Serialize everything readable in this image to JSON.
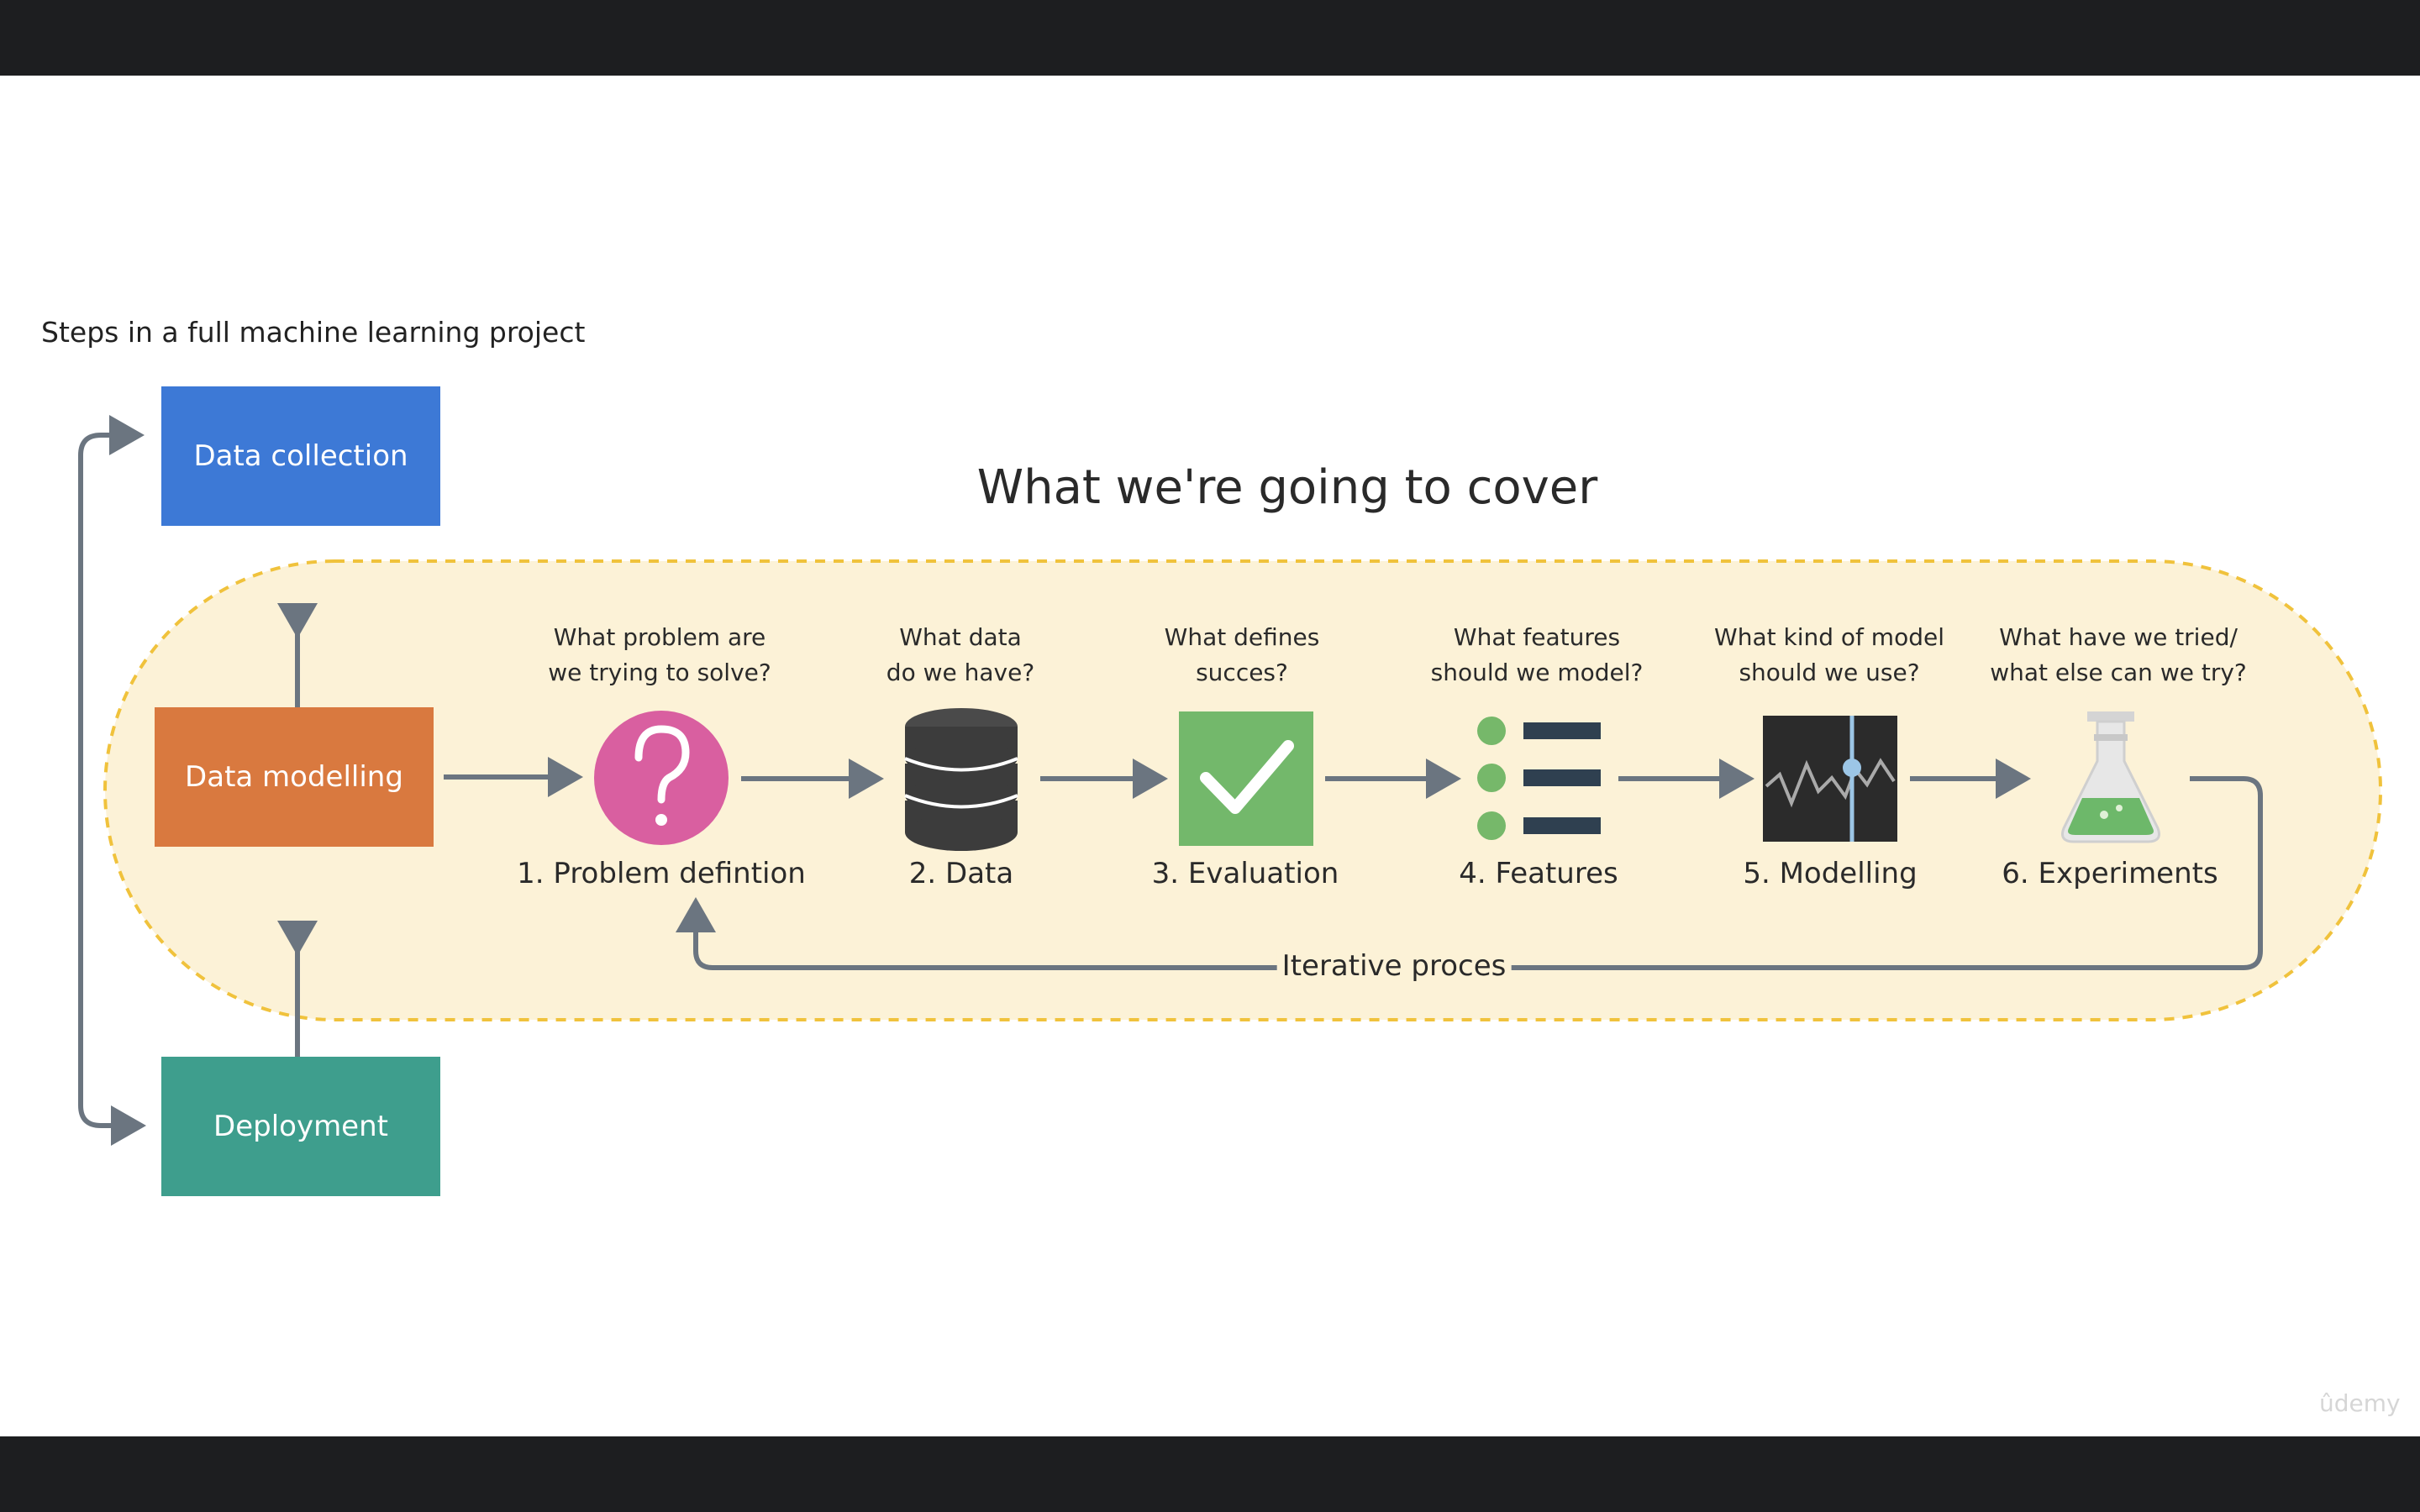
{
  "slide": {
    "subtitle": "Steps in a full machine learning project",
    "heading": "What we're going to cover",
    "watermark": "ûdemy"
  },
  "sidebar_steps": [
    {
      "label": "Data collection",
      "color": "#3d79d6"
    },
    {
      "label": "Data modelling",
      "color": "#d9793f"
    },
    {
      "label": "Deployment",
      "color": "#3e9e8d"
    }
  ],
  "pipeline": [
    {
      "question_line1": "What problem are",
      "question_line2": "we trying to solve?",
      "label": "1. Problem defintion",
      "icon": "question-mark-circle-icon",
      "color": "#d95fa0"
    },
    {
      "question_line1": "What data",
      "question_line2": "do we have?",
      "label": "2. Data",
      "icon": "database-icon",
      "color": "#3c3c3c"
    },
    {
      "question_line1": "What defines",
      "question_line2": "succes?",
      "label": "3. Evaluation",
      "icon": "checkmark-icon",
      "color": "#73b86b"
    },
    {
      "question_line1": "What features",
      "question_line2": "should we model?",
      "label": "4. Features",
      "icon": "bullet-list-icon",
      "color": "#76b86a"
    },
    {
      "question_line1": "What kind of model",
      "question_line2": "should we use?",
      "label": "5. Modelling",
      "icon": "model-chart-icon",
      "color": "#2b2b2b"
    },
    {
      "question_line1": "What have we tried/",
      "question_line2": "what else can we try?",
      "label": "6. Experiments",
      "icon": "flask-icon",
      "color": "#6db86a"
    }
  ],
  "loop_label": "Iterative proces",
  "colors": {
    "band_fill": "#fcf2d7",
    "band_border": "#f0c23c",
    "arrow": "#6b7580"
  }
}
